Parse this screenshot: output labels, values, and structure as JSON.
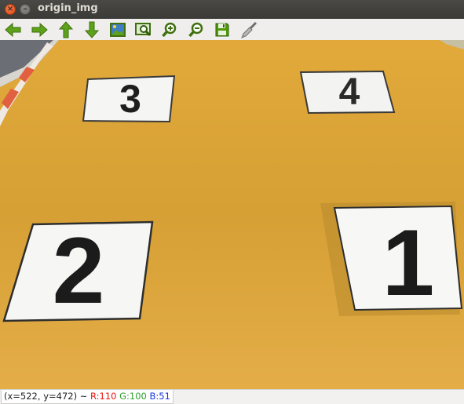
{
  "window": {
    "title": "origin_img",
    "close_glyph": "×",
    "minimize_glyph": "–"
  },
  "toolbar": {
    "buttons": [
      {
        "name": "arrow-left-icon",
        "color": "#4e9a06"
      },
      {
        "name": "arrow-right-icon",
        "color": "#4e9a06"
      },
      {
        "name": "arrow-up-icon",
        "color": "#4e9a06"
      },
      {
        "name": "arrow-down-icon",
        "color": "#4e9a06"
      },
      {
        "name": "image-icon",
        "color": "#4e9a06"
      },
      {
        "name": "zoom-fit-icon",
        "color": "#4e9a06"
      },
      {
        "name": "zoom-in-icon",
        "color": "#4e9a06"
      },
      {
        "name": "zoom-out-icon",
        "color": "#4e9a06"
      },
      {
        "name": "save-icon",
        "color": "#4e9a06"
      },
      {
        "name": "brush-icon",
        "color": "#888a85"
      }
    ]
  },
  "image": {
    "cards": [
      {
        "label": "3"
      },
      {
        "label": "4"
      },
      {
        "label": "2"
      },
      {
        "label": "1"
      }
    ],
    "colors": {
      "background": "#c99a2e",
      "card": "#f4f4f2",
      "digit": "#1c1c1c"
    }
  },
  "status": {
    "coords": "(x=522, y=472) ~",
    "r": "R:110",
    "g": "G:100",
    "b": "B:51"
  }
}
